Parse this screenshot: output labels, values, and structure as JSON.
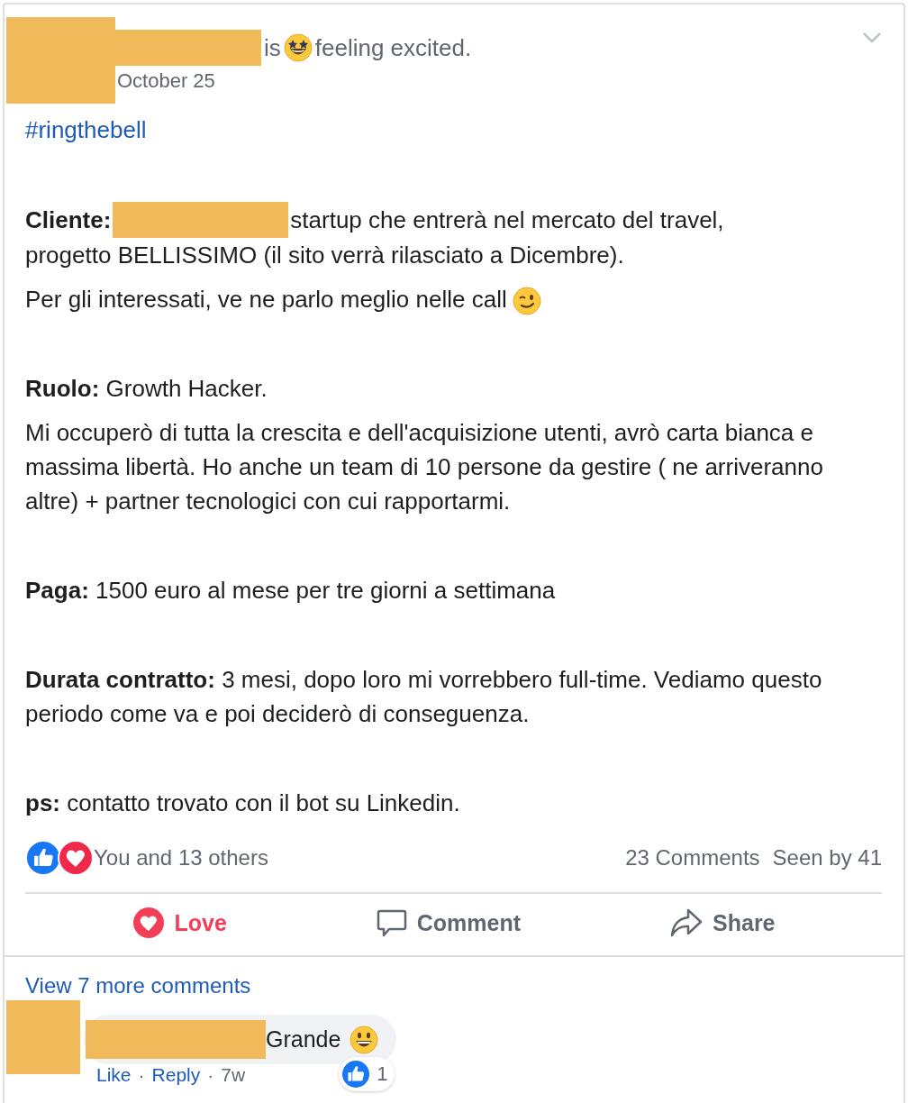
{
  "header": {
    "verb": "is",
    "feeling": "feeling excited.",
    "date": "October 25"
  },
  "sections": [
    [
      {
        "kind": "hashtag",
        "text": "#ringthebell"
      }
    ],
    [
      {
        "kind": "redacted",
        "label": "Cliente:",
        "lines": [
          "startup che entrerà nel mercato del travel,",
          "progetto BELLISSIMO (il sito verrà rilasciato a Dicembre)."
        ]
      },
      {
        "kind": "emoji",
        "text": "Per gli interessati, ve ne parlo meglio nelle call"
      }
    ],
    [
      {
        "kind": "labeled",
        "text": "**Ruolo:** Growth Hacker."
      },
      {
        "kind": "plain",
        "text": "Mi occuperò di tutta la crescita e dell'acquisizione utenti, avrò carta bianca e massima libertà. Ho anche un team di 10 persone da gestire ( ne arriveranno altre) + partner tecnologici con cui rapportarmi."
      }
    ],
    [
      {
        "kind": "labeled",
        "text": "**Paga:** 1500 euro al mese per tre giorni a settimana"
      }
    ],
    [
      {
        "kind": "labeled",
        "text": "**Durata contratto:** 3 mesi, dopo loro mi vorrebbero full-time. Vediamo questo periodo come va e poi deciderò di conseguenza."
      }
    ],
    [
      {
        "kind": "labeled",
        "text": "**ps:** contatto trovato con il bot su Linkedin."
      }
    ]
  ],
  "reactions": {
    "summary": "You and 13 others",
    "comments": "23 Comments",
    "seen": "Seen by 41"
  },
  "actions": [
    {
      "kind": "love",
      "label": "Love",
      "selected": true
    },
    {
      "kind": "comment",
      "label": "Comment",
      "selected": false
    },
    {
      "kind": "share",
      "label": "Share",
      "selected": false
    }
  ],
  "comments": {
    "more": "View 7 more comments",
    "items": [
      {
        "text": "Grande",
        "reaction_count": "1",
        "meta": [
          {
            "kind": "link",
            "text": "Like"
          },
          {
            "kind": "separator",
            "text": "·"
          },
          {
            "kind": "link",
            "text": "Reply"
          },
          {
            "kind": "separator",
            "text": "·"
          },
          {
            "kind": "time",
            "text": "7w"
          }
        ]
      }
    ]
  }
}
